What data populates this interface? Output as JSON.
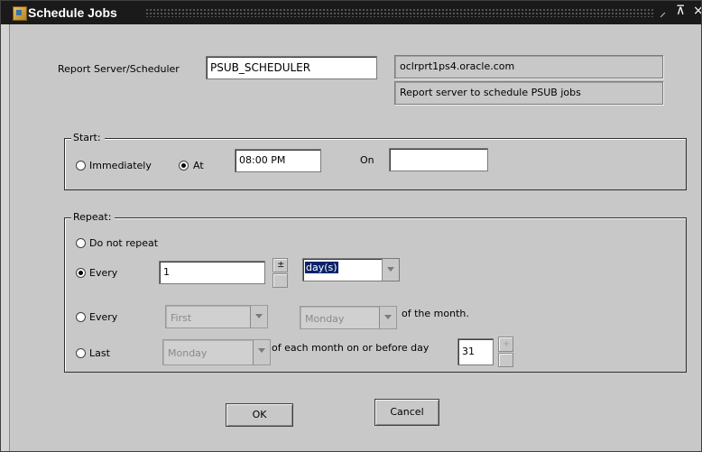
{
  "window": {
    "title": "Schedule Jobs",
    "min_glyph": "⸝",
    "max_glyph": "⊼",
    "close_glyph": "×"
  },
  "server": {
    "label": "Report Server/Scheduler",
    "value": "PSUB_SCHEDULER",
    "host": "oclrprt1ps4.oracle.com",
    "description": "Report server to schedule PSUB jobs"
  },
  "start": {
    "title": "Start:",
    "immediately_label": "Immediately",
    "at_label": "At",
    "time_value": "08:00 PM",
    "on_label": "On",
    "date_value": "",
    "selected": "at"
  },
  "repeat": {
    "title": "Repeat:",
    "no_repeat_label": "Do not repeat",
    "every_label": "Every",
    "interval_value": "1",
    "unit_value": "day(s)",
    "every2_label": "Every",
    "ordinal_value": "First",
    "weekday_value": "Monday",
    "of_month_label": "of the month.",
    "last_label": "Last",
    "last_weekday_value": "Monday",
    "before_day_label": "of each month on or before day",
    "day_value": "31",
    "selected": "every"
  },
  "buttons": {
    "ok": "OK",
    "cancel": "Cancel"
  }
}
